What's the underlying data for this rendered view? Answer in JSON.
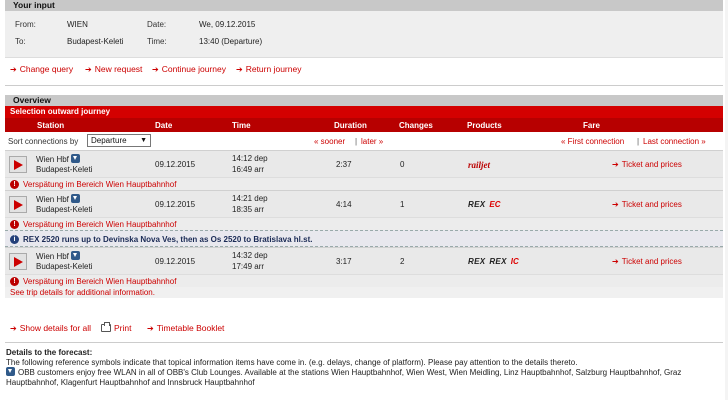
{
  "input": {
    "heading": "Your input",
    "from_label": "From:",
    "from_value": "WIEN",
    "to_label": "To:",
    "to_value": "Budapest-Keleti",
    "date_label": "Date:",
    "date_value": "We, 09.12.2015",
    "time_label": "Time:",
    "time_value": "13:40 (Departure)"
  },
  "actions": {
    "change_query": "Change query",
    "new_request": "New request",
    "continue_journey": "Continue journey",
    "return_journey": "Return journey"
  },
  "overview": {
    "heading": "Overview",
    "selection": "Selection outward journey",
    "columns": {
      "station": "Station",
      "date": "Date",
      "time": "Time",
      "duration": "Duration",
      "changes": "Changes",
      "products": "Products",
      "fare": "Fare"
    },
    "sort_label": "Sort connections by",
    "sort_value": "Departure",
    "sooner": "« sooner",
    "later": "later »",
    "first_connection": "« First connection",
    "last_connection": "Last connection »",
    "pipe": "|"
  },
  "connections": [
    {
      "from": "Wien Hbf",
      "to": "Budapest-Keleti",
      "date": "09.12.2015",
      "dep": "14:12 dep",
      "arr": "16:49 arr",
      "duration": "2:37",
      "changes": "0",
      "products": [
        "railjet"
      ],
      "fare_link": "Ticket and prices",
      "delay": "Verspätung im Bereich Wien Hauptbahnhof"
    },
    {
      "from": "Wien Hbf",
      "to": "Budapest-Keleti",
      "date": "09.12.2015",
      "dep": "14:21 dep",
      "arr": "18:35 arr",
      "duration": "4:14",
      "changes": "1",
      "products": [
        "REX",
        "EC"
      ],
      "fare_link": "Ticket and prices",
      "delay": "Verspätung im Bereich Wien Hauptbahnhof",
      "info": "REX 2520 runs up to Devinska Nova Ves, then as Os 2520 to Bratislava hl.st."
    },
    {
      "from": "Wien Hbf",
      "to": "Budapest-Keleti",
      "date": "09.12.2015",
      "dep": "14:32 dep",
      "arr": "17:49 arr",
      "duration": "3:17",
      "changes": "2",
      "products": [
        "REX",
        "REX",
        "IC"
      ],
      "fare_link": "Ticket and prices",
      "delay": "Verspätung im Bereich Wien Hauptbahnhof"
    }
  ],
  "trip_details_link": "See trip details for additional information.",
  "bottom": {
    "show_details": "Show details for all",
    "print": "Print",
    "timetable": "Timetable Booklet"
  },
  "forecast": {
    "title": "Details to the forecast:",
    "line1": "The following reference symbols indicate that topical information items have come in. (e.g. delays, change of platform). Please pay attention to the details thereto.",
    "line2": "OBB customers enjoy free WLAN in all of OBB's Club Lounges. Available at the stations Wien Hauptbahnhof, Wien West, Wien Meidling, Linz Hauptbahnhof, Salzburg Hauptbahnhof, Graz Hauptbahnhof, Klagenfurt Hauptbahnhof and Innsbruck Hauptbahnhof"
  },
  "colors": {
    "accent_red": "#cc0000",
    "header_red": "#d40000",
    "column_red": "#b70000",
    "info_blue": "#24407a"
  }
}
